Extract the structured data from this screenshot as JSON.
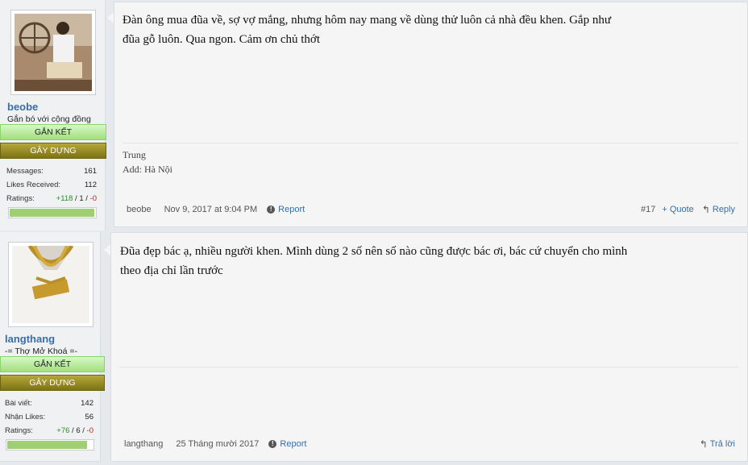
{
  "posts": [
    {
      "username": "beobe",
      "user_title": "Gắn bó với cộng đồng",
      "rank1": "GẮN KẾT",
      "rank2": "GÂY DỰNG",
      "stats": [
        {
          "label": "Messages:",
          "value": "161"
        },
        {
          "label": "Likes Received:",
          "value": "112"
        }
      ],
      "ratings_label": "Ratings:",
      "ratings": {
        "pos": "+118",
        "neu": "1",
        "neg": "-0"
      },
      "rating_fraction": 0.99,
      "message_line1": "Đàn ông mua đũa về, sợ vợ mắng, nhưng hôm nay mang về dùng thử luôn cả nhà đều khen. Gắp như",
      "message_line2": "đũa gỗ luôn. Qua ngon. Cảm ơn chủ thớt",
      "signature_line1": "Trung",
      "signature_line2": "Add: Hà Nội",
      "footer": {
        "user": "beobe",
        "date": "Nov 9, 2017 at 9:04 PM",
        "report": "Report",
        "number": "#17",
        "quote": "+ Quote",
        "reply": "Reply"
      }
    },
    {
      "username": "langthang",
      "user_title": "-= Thợ Mở Khoá =-",
      "rank1": "GẮN KẾT",
      "rank2": "GÂY DỰNG",
      "stats": [
        {
          "label": "Bài viết:",
          "value": "142"
        },
        {
          "label": "Nhận Likes:",
          "value": "56"
        }
      ],
      "ratings_label": "Ratings:",
      "ratings": {
        "pos": "+76",
        "neu": "6",
        "neg": "-0"
      },
      "rating_fraction": 0.93,
      "message_line1": "Đũa đẹp bác ạ, nhiều người khen. Mình dùng 2 số nên số nào cũng được bác ơi, bác cứ chuyển cho mình",
      "message_line2": "theo địa chỉ lần trước",
      "footer": {
        "user": "langthang",
        "date": "25 Tháng mười 2017",
        "report": "Report",
        "reply": "Trả lời"
      }
    }
  ],
  "colors": {
    "link": "#3a6ea5",
    "rank_green": "#9fe07d",
    "rank_olive": "#7d7315",
    "rating_fill": "#9fcf72"
  }
}
